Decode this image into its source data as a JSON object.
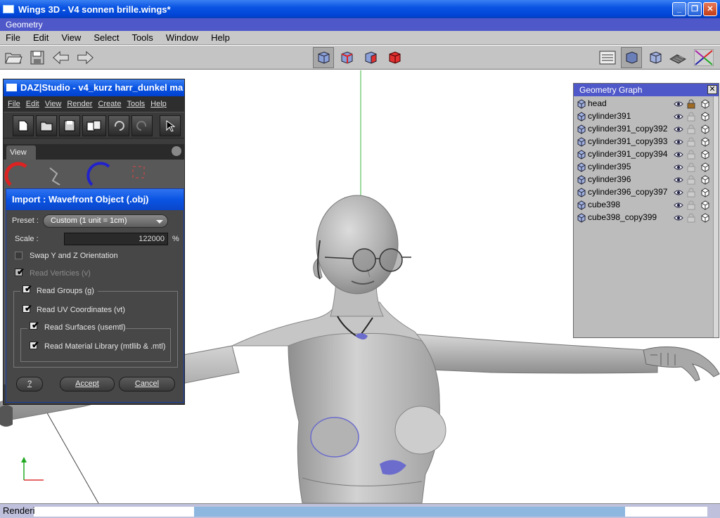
{
  "window": {
    "title": "Wings 3D - V4 sonnen brille.wings*"
  },
  "geometry_strip": {
    "label": "Geometry"
  },
  "menubar": {
    "items": [
      "File",
      "Edit",
      "View",
      "Select",
      "Tools",
      "Window",
      "Help"
    ]
  },
  "daz": {
    "title": "DAZ|Studio - v4_kurz harr_dunkel ma",
    "menu": [
      "File",
      "Edit",
      "View",
      "Render",
      "Create",
      "Tools",
      "Help"
    ],
    "tab_label": "View"
  },
  "import_dialog": {
    "title": "Import : Wavefront Object (.obj)",
    "preset_label": "Preset :",
    "preset_value": "Custom (1 unit = 1cm)",
    "scale_label": "Scale :",
    "scale_value": "122000",
    "scale_unit": "%",
    "options": {
      "swap": "Swap Y and Z Orientation",
      "vertices": "Read Verticies (v)",
      "groups": "Read Groups (g)",
      "uv": "Read UV Coordinates (vt)",
      "surfaces": "Read Surfaces (usemtl)",
      "material": "Read Material Library (mtllib & .mtl)"
    },
    "help_button": "?",
    "accept_button": "Accept",
    "cancel_button": "Cancel"
  },
  "geometry_graph": {
    "title": "Geometry Graph",
    "items": [
      {
        "name": "head",
        "locked": true
      },
      {
        "name": "cylinder391",
        "locked": false
      },
      {
        "name": "cylinder391_copy392",
        "locked": false
      },
      {
        "name": "cylinder391_copy393",
        "locked": false
      },
      {
        "name": "cylinder391_copy394",
        "locked": false
      },
      {
        "name": "cylinder395",
        "locked": false
      },
      {
        "name": "cylinder396",
        "locked": false
      },
      {
        "name": "cylinder396_copy397",
        "locked": false
      },
      {
        "name": "cube398",
        "locked": false
      },
      {
        "name": "cube398_copy399",
        "locked": false
      }
    ]
  },
  "status": {
    "text": "Renderi",
    "progress": 0.84
  },
  "colors": {
    "accent": "#4f58c9",
    "xp_blue": "#0a54e3",
    "mesh": "#b9b9b9",
    "selection": "#6b6ccc"
  }
}
